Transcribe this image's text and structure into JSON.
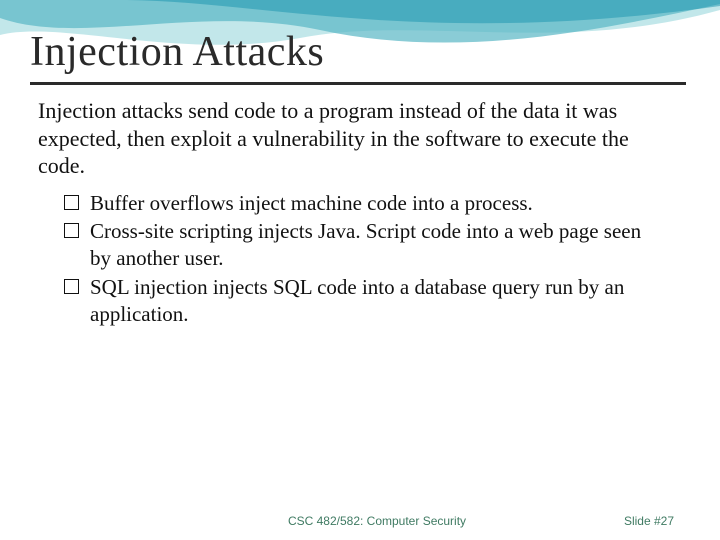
{
  "slide": {
    "title": "Injection Attacks",
    "intro": "Injection attacks send code to a program instead of the data it was expected, then exploit a vulnerability in the software to execute the code.",
    "bullets": [
      "Buffer overflows inject machine code into a process.",
      "Cross-site scripting injects Java. Script code into a web page seen by another user.",
      "SQL injection injects SQL code into a database query run by an application."
    ]
  },
  "footer": {
    "course": "CSC 482/582: Computer Security",
    "slidenum": "Slide #27"
  },
  "theme": {
    "swoosh_light": "#9cd6da",
    "swoosh_dark": "#178fa8",
    "accent_text": "#3f7a62"
  }
}
